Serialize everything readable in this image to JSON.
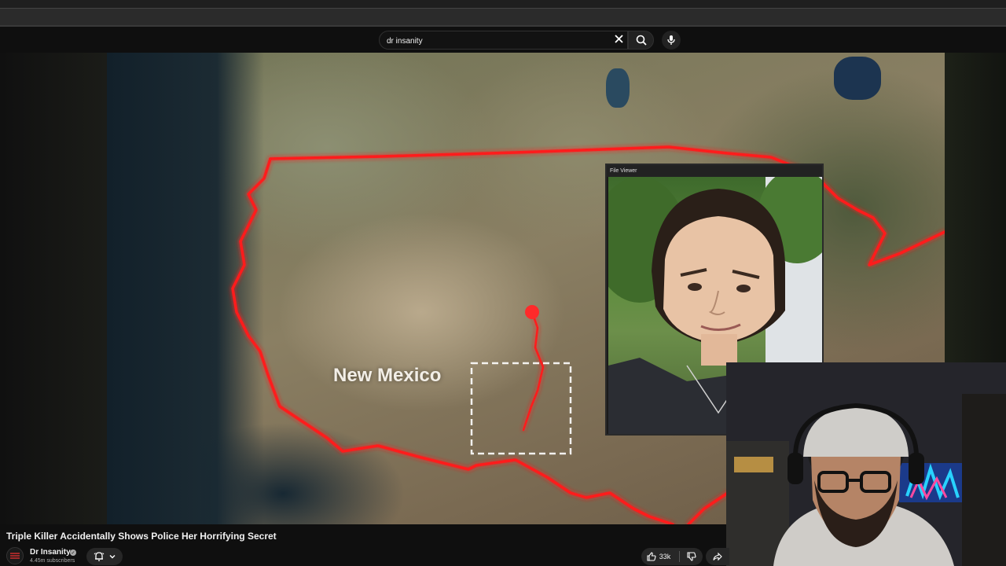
{
  "search": {
    "query": "dr insanity",
    "clear_icon": "close-icon",
    "search_icon": "search-icon",
    "mic_icon": "mic-icon"
  },
  "video": {
    "map_label": "New Mexico",
    "file_viewer_title": "File Viewer",
    "title": "Triple Killer Accidentally Shows Police Her Horrifying Secret"
  },
  "channel": {
    "name": "Dr Insanity",
    "subscribers": "4.45m subscribers",
    "avatar_text": "DR\nINSANITY"
  },
  "actions": {
    "likes": "33k"
  },
  "colors": {
    "route_red": "#ff1a1a",
    "background": "#0f0f0f",
    "pill": "#272727"
  }
}
